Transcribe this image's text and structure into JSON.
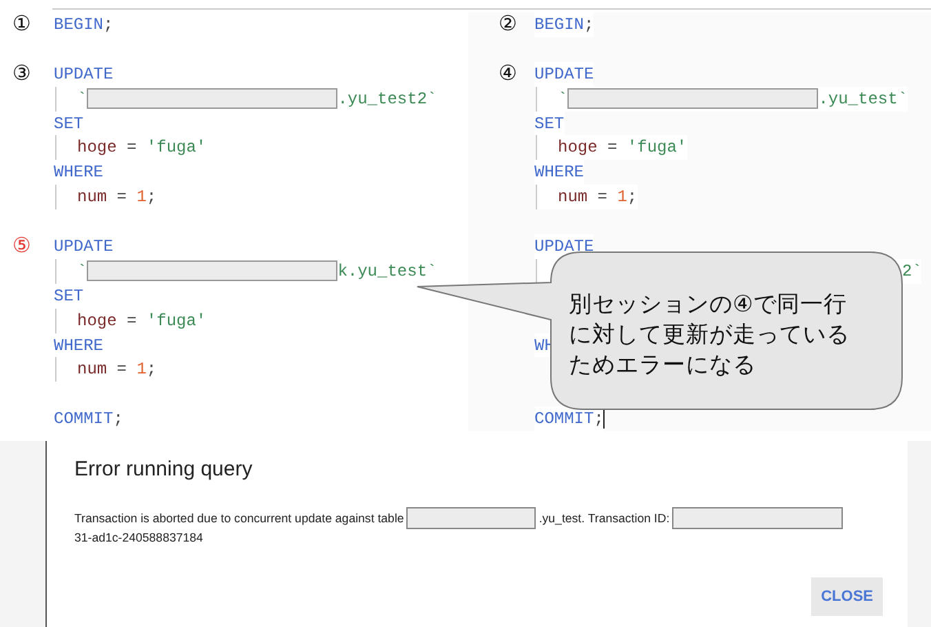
{
  "panels": [
    {
      "lines": [
        {
          "kind": "code",
          "indent": false,
          "marker": {
            "text": "①",
            "color": "#111111"
          },
          "tokens": [
            {
              "kind": "keyword",
              "text": "BEGIN"
            },
            {
              "kind": "punct",
              "text": ";"
            }
          ]
        },
        {
          "kind": "blank"
        },
        {
          "kind": "code",
          "indent": false,
          "marker": {
            "text": "③",
            "color": "#111111"
          },
          "tokens": [
            {
              "kind": "keyword",
              "text": "UPDATE"
            }
          ]
        },
        {
          "kind": "code",
          "indent": true,
          "tokens": [
            {
              "kind": "string",
              "text": "`"
            },
            {
              "kind": "redacted"
            },
            {
              "kind": "string",
              "text": ".yu_test2`"
            }
          ]
        },
        {
          "kind": "code",
          "indent": false,
          "tokens": [
            {
              "kind": "keyword",
              "text": "SET"
            }
          ]
        },
        {
          "kind": "code",
          "indent": true,
          "tokens": [
            {
              "kind": "ident",
              "text": "hoge"
            },
            {
              "kind": "punct",
              "text": " = "
            },
            {
              "kind": "string",
              "text": "'fuga'"
            }
          ]
        },
        {
          "kind": "code",
          "indent": false,
          "tokens": [
            {
              "kind": "keyword",
              "text": "WHERE"
            }
          ]
        },
        {
          "kind": "code",
          "indent": true,
          "tokens": [
            {
              "kind": "ident",
              "text": "num"
            },
            {
              "kind": "punct",
              "text": " = "
            },
            {
              "kind": "number",
              "text": "1"
            },
            {
              "kind": "punct",
              "text": ";"
            }
          ]
        },
        {
          "kind": "blank"
        },
        {
          "kind": "code",
          "indent": false,
          "marker": {
            "text": "⑤",
            "color": "#e53935"
          },
          "tokens": [
            {
              "kind": "keyword",
              "text": "UPDATE"
            }
          ]
        },
        {
          "kind": "code",
          "indent": true,
          "tokens": [
            {
              "kind": "string",
              "text": "`"
            },
            {
              "kind": "redacted"
            },
            {
              "kind": "string",
              "text": "k.yu_test`"
            }
          ]
        },
        {
          "kind": "code",
          "indent": false,
          "tokens": [
            {
              "kind": "keyword",
              "text": "SET"
            }
          ]
        },
        {
          "kind": "code",
          "indent": true,
          "tokens": [
            {
              "kind": "ident",
              "text": "hoge"
            },
            {
              "kind": "punct",
              "text": " = "
            },
            {
              "kind": "string",
              "text": "'fuga'"
            }
          ]
        },
        {
          "kind": "code",
          "indent": false,
          "tokens": [
            {
              "kind": "keyword",
              "text": "WHERE"
            }
          ]
        },
        {
          "kind": "code",
          "indent": true,
          "tokens": [
            {
              "kind": "ident",
              "text": "num"
            },
            {
              "kind": "punct",
              "text": " = "
            },
            {
              "kind": "number",
              "text": "1"
            },
            {
              "kind": "punct",
              "text": ";"
            }
          ]
        },
        {
          "kind": "blank"
        },
        {
          "kind": "code",
          "indent": false,
          "tokens": [
            {
              "kind": "keyword",
              "text": "COMMIT"
            },
            {
              "kind": "punct",
              "text": ";"
            }
          ]
        }
      ]
    },
    {
      "lines": [
        {
          "kind": "code",
          "indent": false,
          "marker": {
            "text": "②",
            "color": "#111111"
          },
          "tokens": [
            {
              "kind": "keyword",
              "text": "BEGIN"
            },
            {
              "kind": "punct",
              "text": ";"
            }
          ]
        },
        {
          "kind": "blank"
        },
        {
          "kind": "code",
          "indent": false,
          "marker": {
            "text": "④",
            "color": "#111111"
          },
          "tokens": [
            {
              "kind": "keyword",
              "text": "UPDATE"
            }
          ]
        },
        {
          "kind": "code",
          "indent": true,
          "tokens": [
            {
              "kind": "string",
              "text": "`"
            },
            {
              "kind": "redacted"
            },
            {
              "kind": "string",
              "text": ".yu_test`"
            }
          ]
        },
        {
          "kind": "code",
          "indent": false,
          "tokens": [
            {
              "kind": "keyword",
              "text": "SET"
            }
          ]
        },
        {
          "kind": "code",
          "indent": true,
          "tokens": [
            {
              "kind": "ident",
              "text": "hoge"
            },
            {
              "kind": "punct",
              "text": " = "
            },
            {
              "kind": "string",
              "text": "'fuga'"
            }
          ]
        },
        {
          "kind": "code",
          "indent": false,
          "tokens": [
            {
              "kind": "keyword",
              "text": "WHERE"
            }
          ]
        },
        {
          "kind": "code",
          "indent": true,
          "tokens": [
            {
              "kind": "ident",
              "text": "num"
            },
            {
              "kind": "punct",
              "text": " = "
            },
            {
              "kind": "number",
              "text": "1"
            },
            {
              "kind": "punct",
              "text": ";"
            }
          ]
        },
        {
          "kind": "blank"
        },
        {
          "kind": "code",
          "indent": false,
          "tokens": [
            {
              "kind": "keyword",
              "text": "UPDATE"
            }
          ]
        },
        {
          "kind": "code",
          "indent": true,
          "tokens": [
            {
              "kind": "gap"
            },
            {
              "kind": "string",
              "text": "2`"
            }
          ]
        },
        {
          "kind": "blank"
        },
        {
          "kind": "blank"
        },
        {
          "kind": "code",
          "indent": false,
          "tokens": [
            {
              "kind": "keyword",
              "text": "WH"
            }
          ]
        },
        {
          "kind": "blank"
        },
        {
          "kind": "blank"
        },
        {
          "kind": "code",
          "indent": false,
          "cursor": true,
          "tokens": [
            {
              "kind": "keyword",
              "text": "COMMIT"
            },
            {
              "kind": "punct",
              "text": ";"
            }
          ]
        }
      ]
    }
  ],
  "callout": {
    "lines": [
      "別セッションの④で同一行",
      "に対して更新が走っている",
      "ためエラーになる"
    ]
  },
  "dialog": {
    "title": "Error running query",
    "message": [
      {
        "kind": "text",
        "text": "Transaction is aborted due to concurrent update against table"
      },
      {
        "kind": "redacted"
      },
      {
        "kind": "text",
        "text": ".yu_test. Transaction ID:"
      },
      {
        "kind": "redacted"
      },
      {
        "kind": "break"
      },
      {
        "kind": "text",
        "text": "31-ad1c-240588837184"
      }
    ],
    "button": "CLOSE"
  }
}
